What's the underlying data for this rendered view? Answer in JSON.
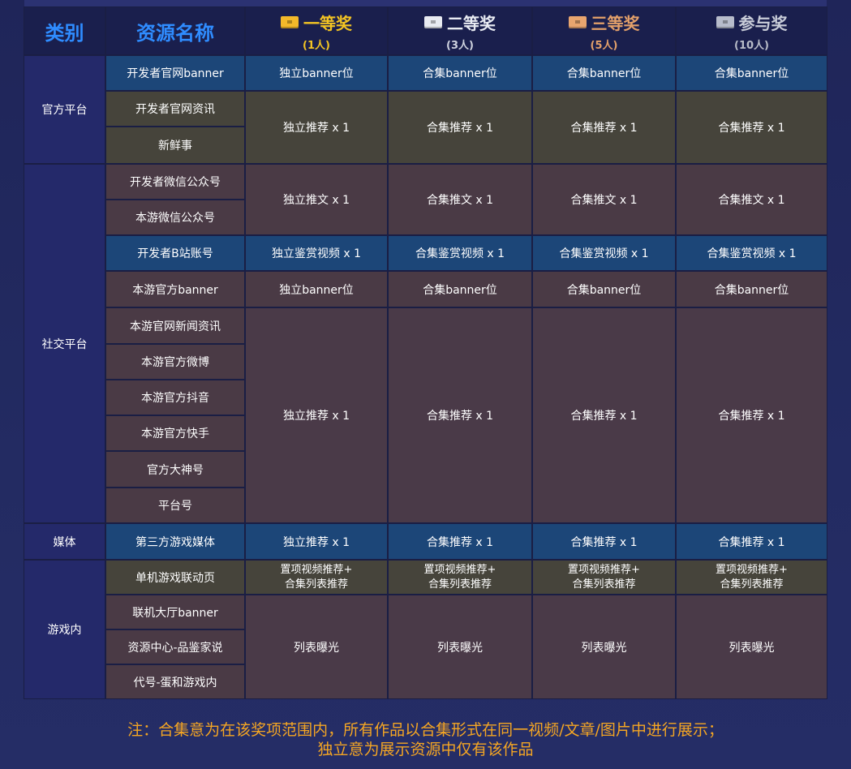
{
  "header": {
    "category": "类别",
    "resource": "资源名称",
    "prizes": [
      {
        "icon": "chest-gold-icon",
        "title": "一等奖",
        "count": "(1人)"
      },
      {
        "icon": "chest-silver-icon",
        "title": "二等奖",
        "count": "(3人)"
      },
      {
        "icon": "chest-bronze-icon",
        "title": "三等奖",
        "count": "(5人)"
      },
      {
        "icon": "chest-gray-icon",
        "title": "参与奖",
        "count": "(10人)"
      }
    ]
  },
  "categories": {
    "official": "官方平台",
    "social": "社交平台",
    "media": "媒体",
    "ingame": "游戏内"
  },
  "resources": {
    "dev_banner": "开发者官网banner",
    "dev_news": "开发者官网资讯",
    "xinxianshi": "新鲜事",
    "dev_wechat": "开发者微信公众号",
    "game_wechat": "本游微信公众号",
    "dev_bilibili": "开发者B站账号",
    "game_banner": "本游官方banner",
    "game_news": "本游官网新闻资讯",
    "game_weibo": "本游官方微博",
    "game_douyin": "本游官方抖音",
    "game_kuaishou": "本游官方快手",
    "dashen": "官方大神号",
    "platform": "平台号",
    "third_media": "第三方游戏媒体",
    "single_page": "单机游戏联动页",
    "lobby_banner": "联机大厅banner",
    "resource_center": "资源中心-品鉴家说",
    "codename": "代号-蛋和游戏内"
  },
  "rewards": {
    "r1": [
      "独立banner位",
      "合集banner位",
      "合集banner位",
      "合集banner位"
    ],
    "r2": [
      "独立推荐 x 1",
      "合集推荐 x 1",
      "合集推荐 x 1",
      "合集推荐 x 1"
    ],
    "r3": [
      "独立推文 x 1",
      "合集推文 x 1",
      "合集推文 x 1",
      "合集推文 x 1"
    ],
    "r4": [
      "独立鉴赏视频 x 1",
      "合集鉴赏视频 x 1",
      "合集鉴赏视频 x 1",
      "合集鉴赏视频 x 1"
    ],
    "r5": [
      "独立banner位",
      "合集banner位",
      "合集banner位",
      "合集banner位"
    ],
    "r6": [
      "独立推荐 x 1",
      "合集推荐 x 1",
      "合集推荐 x 1",
      "合集推荐 x 1"
    ],
    "r7": [
      "独立推荐 x 1",
      "合集推荐 x 1",
      "合集推荐 x 1",
      "合集推荐 x 1"
    ],
    "r8_line1": [
      "置项视频推荐+",
      "置项视频推荐+",
      "置项视频推荐+",
      "置项视频推荐+"
    ],
    "r8_line2": [
      "合集列表推荐",
      "合集列表推荐",
      "合集列表推荐",
      "合集列表推荐"
    ],
    "r9": [
      "列表曝光",
      "列表曝光",
      "列表曝光",
      "列表曝光"
    ]
  },
  "note": {
    "line1": "注：合集意为在该奖项范围内，所有作品以合集形式在同一视频/文章/图片中进行展示；",
    "line2": "独立意为展示资源中仅有该作品"
  },
  "colors": {
    "background": "#232a5e",
    "header_accent": "#2f8cff",
    "blue_row": "#1c4678",
    "olive_row": "#46443b",
    "plum_row": "#4a3a45",
    "note": "#f5a623"
  }
}
